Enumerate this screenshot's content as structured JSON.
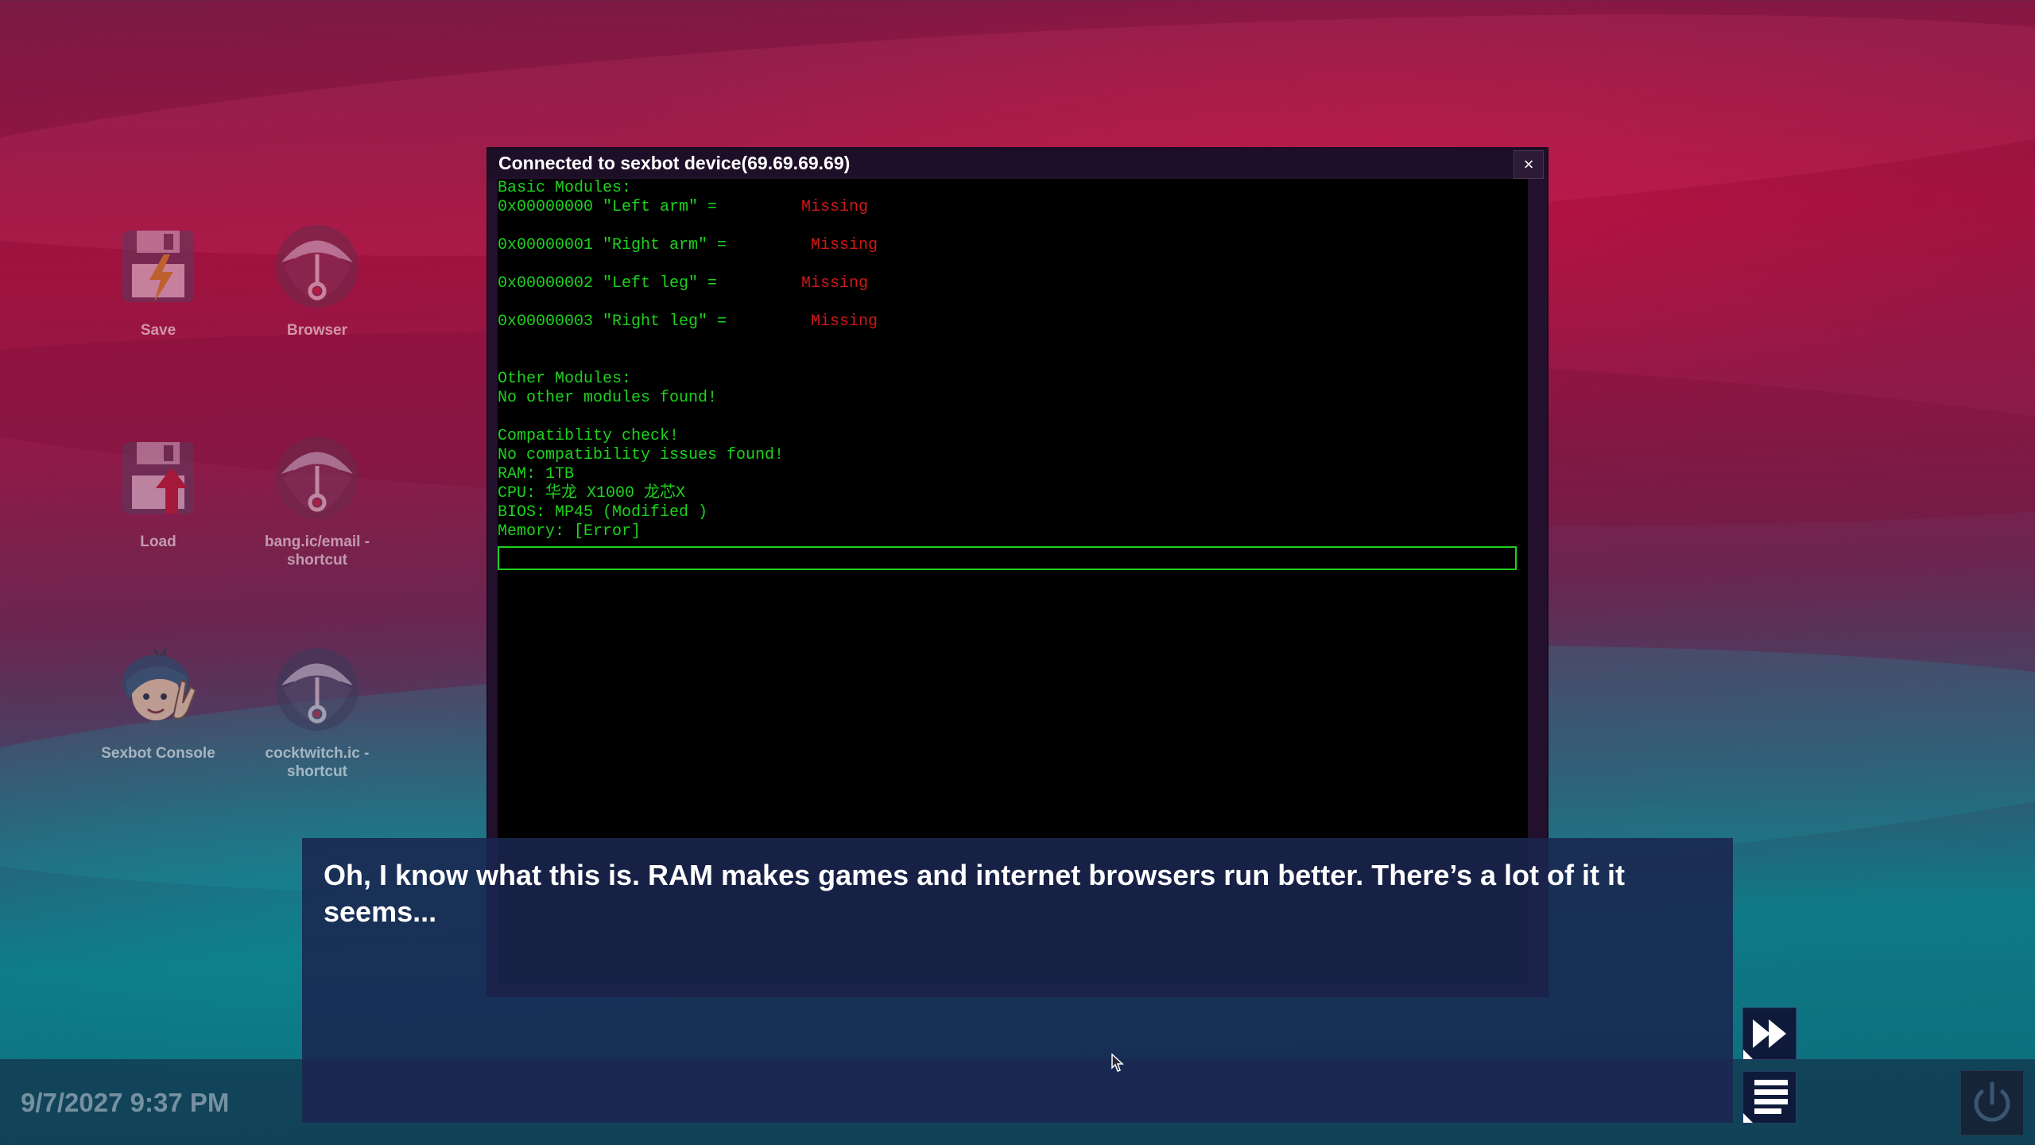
{
  "desktop": {
    "icons": [
      {
        "label": "Save",
        "icon": "floppy-disk-lightning-icon"
      },
      {
        "label": "Browser",
        "icon": "browser-umbrella-icon"
      },
      {
        "label": "Load",
        "icon": "floppy-disk-arrow-up-icon"
      },
      {
        "label": "bang.ic/email - shortcut",
        "icon": "browser-umbrella-icon"
      },
      {
        "label": "Sexbot Console",
        "icon": "character-avatar-icon"
      },
      {
        "label": "cocktwitch.ic - shortcut",
        "icon": "browser-umbrella-icon"
      }
    ]
  },
  "console": {
    "title": "Connected to sexbot device(69.69.69.69)",
    "close_label": "×",
    "lines": {
      "basic_header": "Basic Modules:",
      "m0": "0x00000000 \"Left arm\" =",
      "m1": "0x00000001 \"Right arm\" =",
      "m2": "0x00000002 \"Left leg\" =",
      "m3": "0x00000003 \"Right leg\" =",
      "status": "Missing",
      "other_header": "Other Modules:",
      "other_none": "No other modules found!",
      "compat_header": "Compatiblity check!",
      "compat_none": "No compatibility issues found!",
      "ram": "RAM: 1TB",
      "cpu": "CPU: 华龙 X1000 龙芯X",
      "bios": "BIOS: MP45 (Modified )",
      "memory": "Memory: [Error]"
    },
    "input_value": ""
  },
  "dialogue": {
    "text": "Oh, I know what this is. RAM makes games and internet browsers run better. There’s a lot of it it seems..."
  },
  "taskbar": {
    "clock": "9/7/2027 9:37 PM"
  },
  "colors": {
    "terminal_green": "#1ed11e",
    "missing_red": "#d01818",
    "dialogue_bg": "#1a2650"
  }
}
